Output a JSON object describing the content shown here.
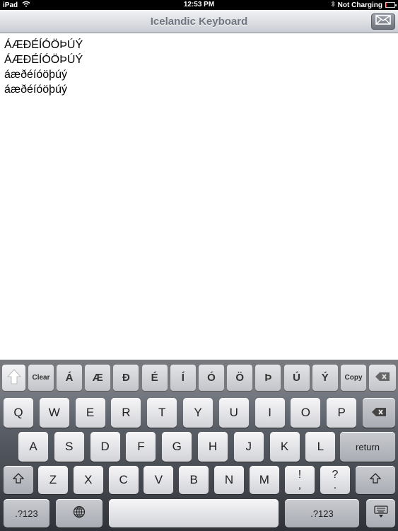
{
  "status_bar": {
    "device": "iPad",
    "time": "12:53 PM",
    "charging": "Not Charging",
    "battery_level": 0.1
  },
  "nav_bar": {
    "title": "Icelandic Keyboard",
    "mail_icon": "envelope-icon"
  },
  "text_lines": [
    "ÁÆÐÉÍÓÖÞÚÝ",
    "ÁÆÐÉÍÓÖÞÚÝ",
    "áæðéíóöþúý",
    "áæðéíóöþúý"
  ],
  "accessory_bar": {
    "shift_icon": "shift-arrow-icon",
    "clear": "Clear",
    "letters": [
      "Á",
      "Æ",
      "Ð",
      "É",
      "Í",
      "Ó",
      "Ö",
      "Þ",
      "Ú",
      "Ý"
    ],
    "copy": "Copy",
    "delete_icon": "delete-icon"
  },
  "keyboard": {
    "row1": [
      "Q",
      "W",
      "E",
      "R",
      "T",
      "Y",
      "U",
      "I",
      "O",
      "P"
    ],
    "row2": [
      "A",
      "S",
      "D",
      "F",
      "G",
      "H",
      "J",
      "K",
      "L"
    ],
    "row3": [
      "Z",
      "X",
      "C",
      "V",
      "B",
      "N",
      "M"
    ],
    "punct1": {
      "top": "!",
      "bottom": ","
    },
    "punct2": {
      "top": "?",
      "bottom": "."
    },
    "return": "return",
    "numbers_left": ".?123",
    "numbers_right": ".?123"
  }
}
